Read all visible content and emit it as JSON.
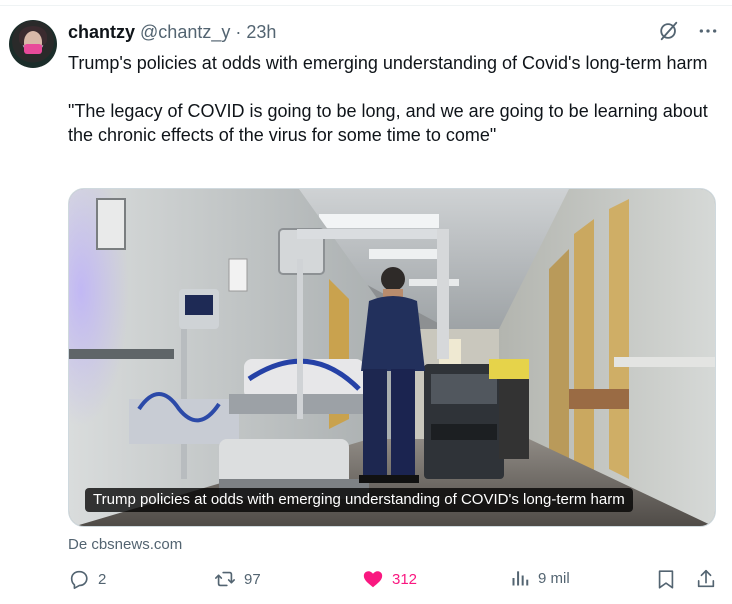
{
  "author": {
    "name": "chantzy",
    "handle": "@chantz_y",
    "time": "· 23h"
  },
  "tweet": {
    "line1": "Trump's policies at odds with emerging understanding of Covid's long-term harm",
    "line2": "\"The legacy of COVID is going to be long, and we are going to be learning about the chronic effects of the virus for some time to come\""
  },
  "card": {
    "caption": "Trump policies at odds with emerging understanding of COVID's long-term harm",
    "source": "De cbsnews.com"
  },
  "actions": {
    "replies": "2",
    "reposts": "97",
    "likes": "312",
    "views": "9 mil"
  },
  "icons": {
    "top": [
      "grok-icon",
      "more-icon"
    ],
    "actions": [
      "reply-icon",
      "repost-icon",
      "heart-icon",
      "views-icon",
      "bookmark-icon",
      "share-icon"
    ]
  },
  "colors": {
    "text": "#0f1419",
    "muted": "#536471",
    "like": "#f91880"
  }
}
